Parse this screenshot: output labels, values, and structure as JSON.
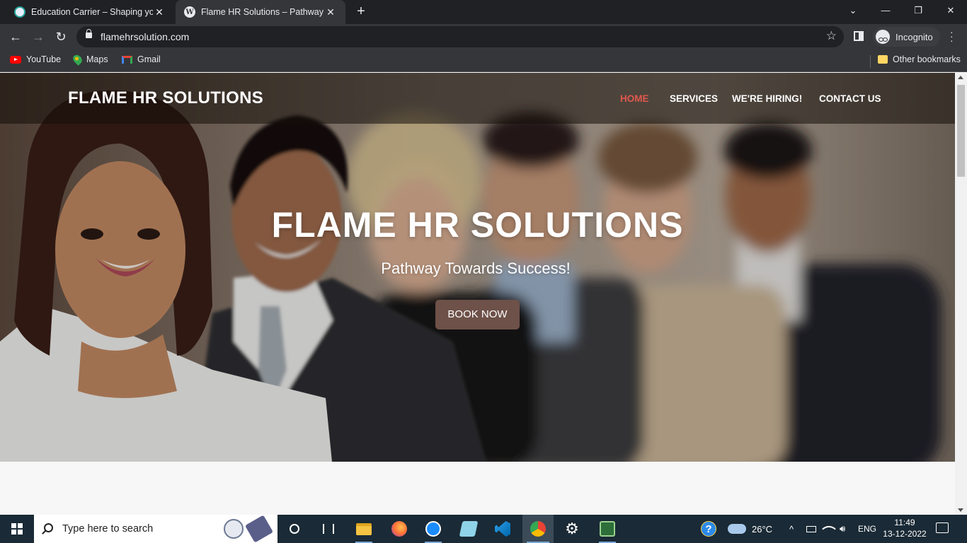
{
  "browser": {
    "tabs": [
      {
        "title": "Education Carrier – Shaping your",
        "active": false
      },
      {
        "title": "Flame HR Solutions – Pathway To",
        "active": true
      }
    ],
    "new_tab_label": "+",
    "window_controls": {
      "minimize": "—",
      "restore": "❐",
      "close": "✕"
    },
    "url": "flamehrsolution.com",
    "profile_label": "Incognito",
    "bookmarks": [
      {
        "label": "YouTube"
      },
      {
        "label": "Maps"
      },
      {
        "label": "Gmail"
      }
    ],
    "other_bookmarks": "Other bookmarks"
  },
  "site": {
    "brand": "FLAME HR SOLUTIONS",
    "menu": [
      {
        "label": "HOME",
        "active": true
      },
      {
        "label": "SERVICES",
        "active": false
      },
      {
        "label": "WE'RE HIRING!",
        "active": false
      },
      {
        "label": "CONTACT US",
        "active": false
      }
    ],
    "hero_title": "FLAME HR SOLUTIONS",
    "hero_subtitle": "Pathway Towards Success!",
    "cta_label": "BOOK NOW",
    "colors": {
      "accent_active": "#e0584d",
      "cta_bg": "#6e5149"
    }
  },
  "taskbar": {
    "search_placeholder": "Type here to search",
    "weather": "26°C",
    "language": "ENG",
    "time": "11:49",
    "date": "13-12-2022"
  }
}
